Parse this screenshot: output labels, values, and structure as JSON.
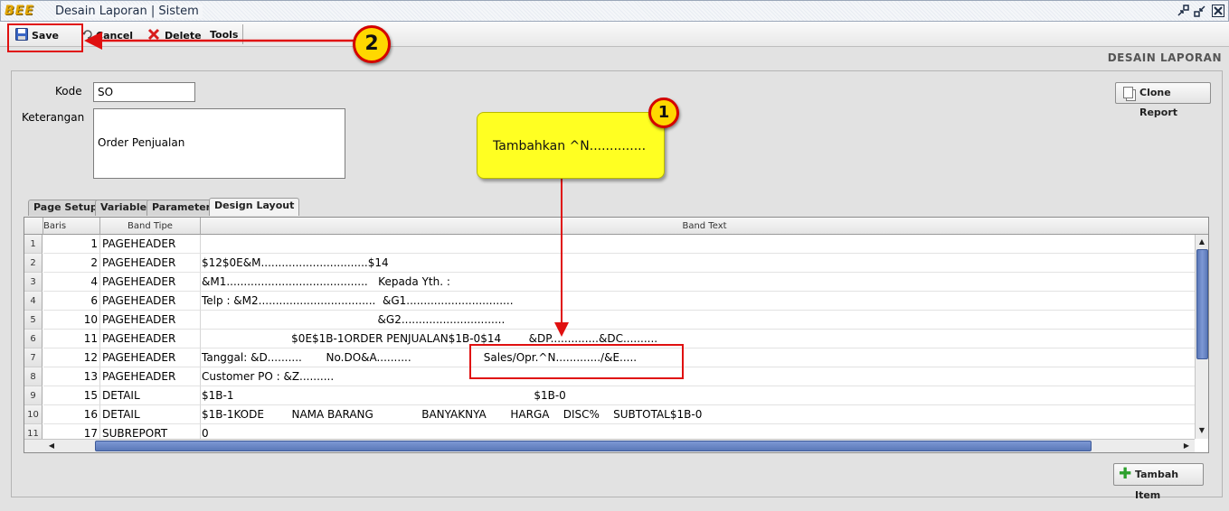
{
  "window": {
    "logo": "BEE",
    "title": "Desain Laporan | Sistem",
    "controls": [
      "restore-icon",
      "minimize-icon",
      "close-icon"
    ]
  },
  "toolbar": {
    "save": "Save",
    "cancel": "Cancel",
    "delete": "Delete",
    "tools": "Tools"
  },
  "header_label": "DESAIN LAPORAN",
  "form": {
    "kode_label": "Kode",
    "kode_value": "SO",
    "keterangan_label": "Keterangan",
    "keterangan_value": "Order Penjualan",
    "clone_button": "Clone Report"
  },
  "tabs": [
    {
      "label": "Page Setup",
      "active": false
    },
    {
      "label": "Variable",
      "active": false
    },
    {
      "label": "Parameter",
      "active": false
    },
    {
      "label": "Design Layout",
      "active": true
    }
  ],
  "grid": {
    "columns": [
      "Baris",
      "Band Tipe",
      "Band Text"
    ],
    "rows": [
      {
        "n": "1",
        "baris": "1",
        "tipe": "PAGEHEADER",
        "text": ""
      },
      {
        "n": "2",
        "baris": "2",
        "tipe": "PAGEHEADER",
        "text": "$12$0E&M...............................$14"
      },
      {
        "n": "3",
        "baris": "4",
        "tipe": "PAGEHEADER",
        "text": "&M1.........................................   Kepada Yth. :"
      },
      {
        "n": "4",
        "baris": "6",
        "tipe": "PAGEHEADER",
        "text": "Telp : &M2..................................  &G1..............................."
      },
      {
        "n": "5",
        "baris": "10",
        "tipe": "PAGEHEADER",
        "text": "                                                   &G2.............................."
      },
      {
        "n": "6",
        "baris": "11",
        "tipe": "PAGEHEADER",
        "text": "                          $0E$1B-1ORDER PENJUALAN$1B-0$14        &DP..............&DC.........."
      },
      {
        "n": "7",
        "baris": "12",
        "tipe": "PAGEHEADER",
        "text": "Tanggal: &D..........       No.DO&A..........                     Sales/Opr.^N............./&E....."
      },
      {
        "n": "8",
        "baris": "13",
        "tipe": "PAGEHEADER",
        "text": "Customer PO : &Z.........."
      },
      {
        "n": "9",
        "baris": "15",
        "tipe": "DETAIL",
        "text": "$1B-1                                                                                       $1B-0"
      },
      {
        "n": "10",
        "baris": "16",
        "tipe": "DETAIL",
        "text": "$1B-1KODE        NAMA BARANG              BANYAKNYA       HARGA    DISC%    SUBTOTAL$1B-0"
      },
      {
        "n": "11",
        "baris": "17",
        "tipe": "SUBREPORT",
        "text": "0"
      }
    ],
    "vertical_scroll_fraction": 0,
    "horizontal_scroll_fraction": 0
  },
  "add_button": "Tambah Item",
  "annotations": {
    "note_text": "Tambahkan ^N..............",
    "badge_1": "1",
    "badge_2": "2",
    "accent_color": "#e01010",
    "note_color": "#ffff22"
  }
}
